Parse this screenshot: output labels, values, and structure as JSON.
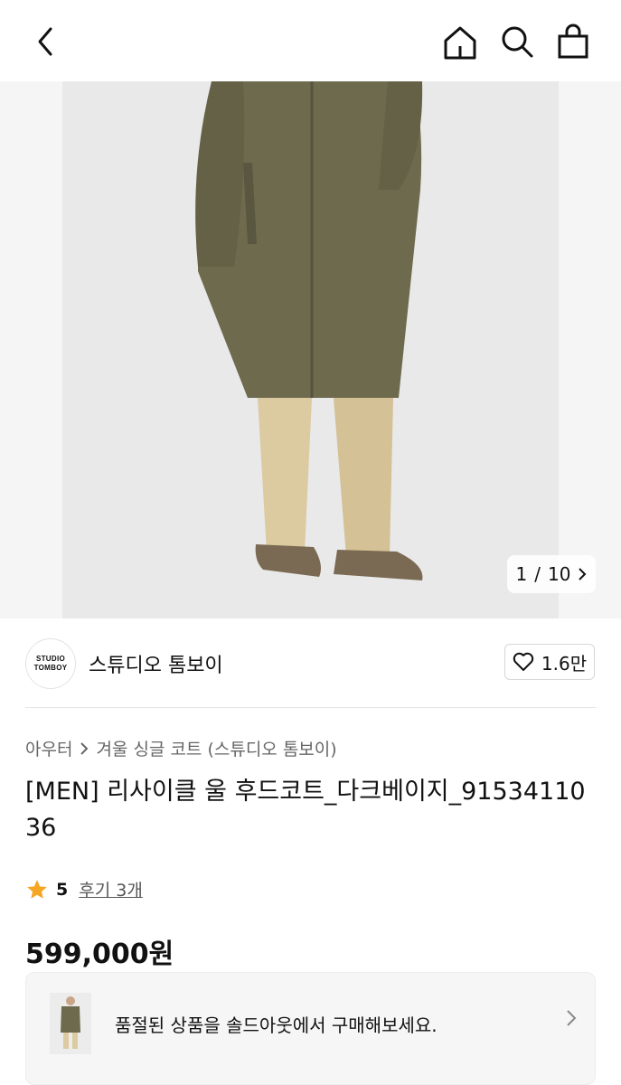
{
  "header": {
    "icons": [
      "chevron-left-icon",
      "home-icon",
      "search-icon",
      "shopping-bag-icon"
    ]
  },
  "gallery": {
    "current_page": "1",
    "separator": "/",
    "total_pages": "10"
  },
  "brand": {
    "logo_line1": "STUDIO",
    "logo_line2": "TOMBOY",
    "name": "스튜디오 톰보이",
    "like_count": "1.6만"
  },
  "product": {
    "breadcrumb": [
      "아우터",
      "겨울 싱글 코트 (스튜디오 톰보이)"
    ],
    "title": "[MEN] 리사이클 울 후드코트_다크베이지_9153411036",
    "rating": "5",
    "reviews_label": "후기 3개",
    "price": "599,000원"
  },
  "soldout_card": {
    "text": "품절된 상품을 솔드아웃에서 구매해보세요."
  },
  "colors": {
    "star": "#f5a623",
    "coat": "#6e6a4e",
    "pants": "#dccaa0",
    "boots": "#7a6a54"
  }
}
